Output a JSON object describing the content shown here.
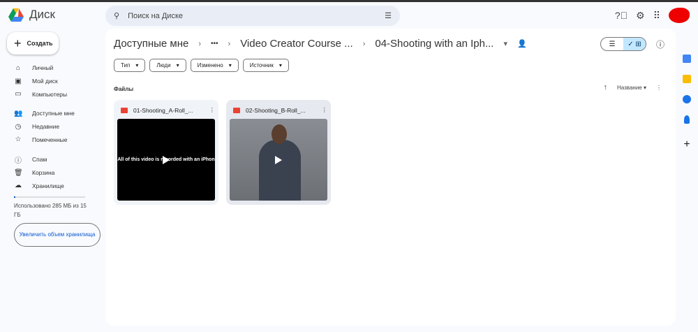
{
  "app": {
    "title": "Диск"
  },
  "search": {
    "placeholder": "Поиск на Диске"
  },
  "sidebar": {
    "create_label": "Создать",
    "items": [
      {
        "label": "Личный",
        "icon": "home-icon"
      },
      {
        "label": "Мой диск",
        "icon": "my-drive-icon"
      },
      {
        "label": "Компьютеры",
        "icon": "computers-icon"
      },
      {
        "label": "Доступные мне",
        "icon": "shared-icon"
      },
      {
        "label": "Недавние",
        "icon": "clock-icon"
      },
      {
        "label": "Помеченные",
        "icon": "star-icon"
      },
      {
        "label": "Спам",
        "icon": "spam-icon"
      },
      {
        "label": "Корзина",
        "icon": "trash-icon"
      },
      {
        "label": "Хранилище",
        "icon": "cloud-icon"
      }
    ],
    "storage_text": "Использовано 285 МБ из 15 ГБ",
    "storage_fraction": 0.02,
    "upgrade_label": "Увеличить объем хранилища"
  },
  "breadcrumb": [
    "Доступные мне",
    "•••",
    "Video Creator Course ...",
    "04-Shooting with an Iph..."
  ],
  "filters": [
    "Тип",
    "Люди",
    "Изменено",
    "Источник"
  ],
  "section_label": "Файлы",
  "sort": {
    "label": "Название"
  },
  "files": [
    {
      "name": "01-Shooting_A-Roll_...",
      "caption": "All of this video is recorded with an iPhon"
    },
    {
      "name": "02-Shooting_B-Roll_..."
    }
  ]
}
